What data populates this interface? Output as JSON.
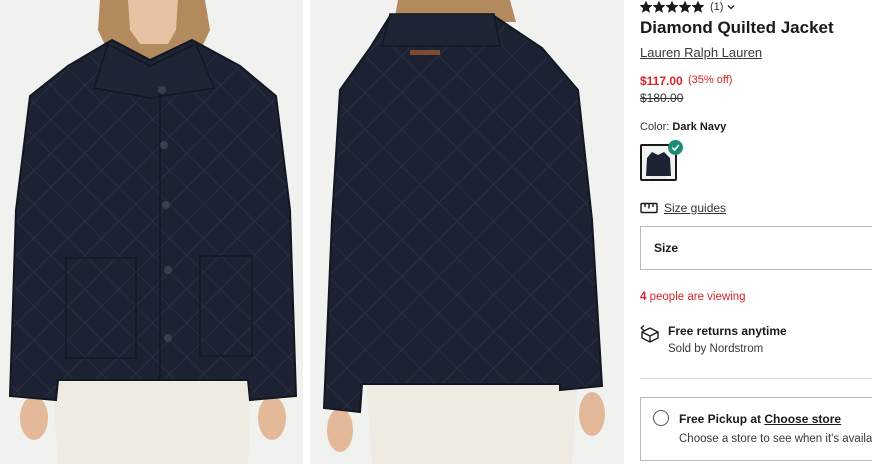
{
  "product": {
    "rating_count": "(1)",
    "title": "Diamond Quilted Jacket",
    "brand": "Lauren Ralph Lauren",
    "price_now": "$117.00",
    "price_off": "(35% off)",
    "price_was": "$180.00",
    "color_label": "Color:",
    "color_value": "Dark Navy",
    "stars_filled": 5
  },
  "size_guides": {
    "label": "Size guides"
  },
  "size_select": {
    "label": "Size"
  },
  "viewing": {
    "count": "4",
    "text": "people are viewing"
  },
  "returns": {
    "title": "Free returns anytime",
    "seller": "Sold by Nordstrom"
  },
  "pickup": {
    "prefix": "Free Pickup at",
    "link": "Choose store",
    "subtext": "Choose a store to see when it's availab"
  },
  "colors": {
    "sale": "#d5252b",
    "check": "#1d8a73",
    "jacket": "#1c2232",
    "pants": "#efeae2"
  },
  "icons": [
    "star-icon",
    "chevron-down-icon",
    "checkmark-icon",
    "ruler-icon",
    "returns-icon"
  ]
}
